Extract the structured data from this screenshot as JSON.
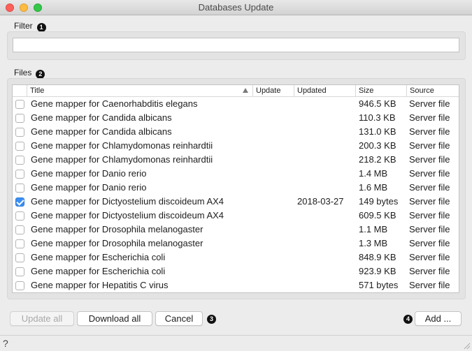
{
  "window": {
    "title": "Databases Update"
  },
  "filter": {
    "label": "Filter",
    "badge": "1",
    "value": "",
    "placeholder": ""
  },
  "files": {
    "label": "Files",
    "badge": "2",
    "columns": [
      "Title",
      "Update",
      "Updated",
      "Size",
      "Source"
    ],
    "sort_column": "Title",
    "rows": [
      {
        "checked": false,
        "title": "Gene mapper for Caenorhabditis elegans",
        "update": "",
        "updated": "",
        "size": "946.5 KB",
        "source": "Server file"
      },
      {
        "checked": false,
        "title": "Gene mapper for Candida albicans",
        "update": "",
        "updated": "",
        "size": "110.3 KB",
        "source": "Server file"
      },
      {
        "checked": false,
        "title": "Gene mapper for Candida albicans",
        "update": "",
        "updated": "",
        "size": "131.0 KB",
        "source": "Server file"
      },
      {
        "checked": false,
        "title": "Gene mapper for Chlamydomonas reinhardtii",
        "update": "",
        "updated": "",
        "size": "200.3 KB",
        "source": "Server file"
      },
      {
        "checked": false,
        "title": "Gene mapper for Chlamydomonas reinhardtii",
        "update": "",
        "updated": "",
        "size": "218.2 KB",
        "source": "Server file"
      },
      {
        "checked": false,
        "title": "Gene mapper for Danio rerio",
        "update": "",
        "updated": "",
        "size": "1.4 MB",
        "source": "Server file"
      },
      {
        "checked": false,
        "title": "Gene mapper for Danio rerio",
        "update": "",
        "updated": "",
        "size": "1.6 MB",
        "source": "Server file"
      },
      {
        "checked": true,
        "title": "Gene mapper for Dictyostelium discoideum AX4",
        "update": "",
        "updated": "2018-03-27",
        "size": "149 bytes",
        "source": "Server file"
      },
      {
        "checked": false,
        "title": "Gene mapper for Dictyostelium discoideum AX4",
        "update": "",
        "updated": "",
        "size": "609.5 KB",
        "source": "Server file"
      },
      {
        "checked": false,
        "title": "Gene mapper for Drosophila melanogaster",
        "update": "",
        "updated": "",
        "size": "1.1 MB",
        "source": "Server file"
      },
      {
        "checked": false,
        "title": "Gene mapper for Drosophila melanogaster",
        "update": "",
        "updated": "",
        "size": "1.3 MB",
        "source": "Server file"
      },
      {
        "checked": false,
        "title": "Gene mapper for Escherichia coli",
        "update": "",
        "updated": "",
        "size": "848.9 KB",
        "source": "Server file"
      },
      {
        "checked": false,
        "title": "Gene mapper for Escherichia coli",
        "update": "",
        "updated": "",
        "size": "923.9 KB",
        "source": "Server file"
      },
      {
        "checked": false,
        "title": "Gene mapper for Hepatitis C virus",
        "update": "",
        "updated": "",
        "size": "571 bytes",
        "source": "Server file"
      }
    ]
  },
  "actions": {
    "update_all": "Update all",
    "download_all": "Download all",
    "cancel": "Cancel",
    "badge_3": "3",
    "badge_4": "4",
    "add": "Add ..."
  },
  "status": {
    "help_icon": "?"
  }
}
